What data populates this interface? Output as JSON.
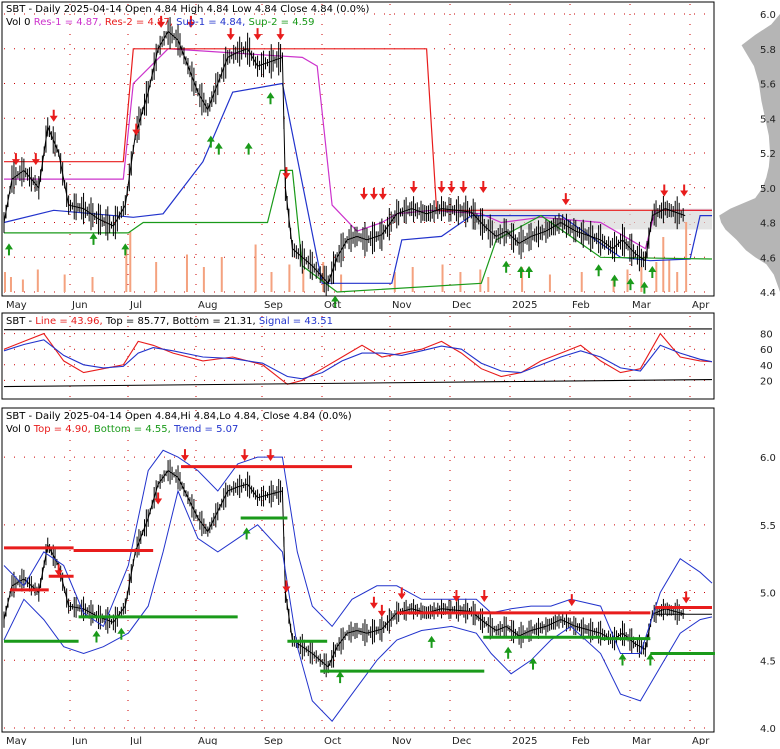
{
  "colors": {
    "price": "#000000",
    "volume": "#f4a27f",
    "resistance": "#e81c1c",
    "resistance_fast": "#cc33cc",
    "support": "#2233cc",
    "support_fast": "#1a9a1a",
    "profile": "#b5b5b5",
    "signal": "#2233cc",
    "line": "#e81c1c",
    "grid": "#cc0000",
    "arrow_up": "#1a9a1a",
    "arrow_down": "#e81c1c"
  },
  "months": [
    "May",
    "Jun",
    "Jul",
    "Aug",
    "Sep",
    "Oct",
    "Nov",
    "Dec",
    "2025",
    "Feb",
    "Mar",
    "Apr"
  ],
  "panel1": {
    "header_ticker": "SBT - Daily 2025-04-14 Open 4.84  High 4.84  Low 4.84  Close 4.84 (0.0%)",
    "legend": [
      {
        "text": "Vol 0",
        "color": "#000000"
      },
      {
        "text": "Res-1 = 4.87,",
        "color": "#cc33cc"
      },
      {
        "text": "Res-2 = 4.87,",
        "color": "#e81c1c"
      },
      {
        "text": "Sup-1 = 4.84,",
        "color": "#2233cc"
      },
      {
        "text": "Sup-2 = 4.59",
        "color": "#1a9a1a"
      }
    ],
    "y_ticks": [
      "6.0",
      "5.8",
      "5.6",
      "5.4",
      "5.2",
      "5.0",
      "4.8",
      "4.6",
      "4.4"
    ]
  },
  "panel2": {
    "header_ticker": "SBT -",
    "legend": [
      {
        "text": "Line = 43.96,",
        "color": "#e81c1c"
      },
      {
        "text": "Top = 85.77,",
        "color": "#000000"
      },
      {
        "text": "Bottom = 21.31,",
        "color": "#000000"
      },
      {
        "text": "Signal = 43.51",
        "color": "#2233cc"
      }
    ],
    "y_ticks": [
      "80",
      "60",
      "40",
      "20"
    ]
  },
  "panel3": {
    "header_ticker": "SBT - Daily 2025-04-14 Open 4.84,Hi 4.84,Lo 4.84, Close 4.84 (0.0%)",
    "legend": [
      {
        "text": "Vol 0",
        "color": "#000000"
      },
      {
        "text": "Top = 4.90,",
        "color": "#e81c1c"
      },
      {
        "text": "Bottom = 4.55,",
        "color": "#1a9a1a"
      },
      {
        "text": "Trend = 5.07",
        "color": "#2233cc"
      }
    ],
    "y_ticks": [
      "6.0",
      "5.5",
      "5.0",
      "4.5",
      "4.0"
    ]
  },
  "chart_data": [
    {
      "type": "line",
      "title": "SBT - Daily 2025-04-14",
      "panel": "price with support/resistance",
      "x_range": [
        "2024-05",
        "2025-04"
      ],
      "ylim": [
        4.4,
        6.0
      ],
      "series": [
        {
          "name": "Close",
          "values": [
            [
              0,
              4.8
            ],
            [
              8,
              5.05
            ],
            [
              20,
              5.1
            ],
            [
              35,
              5.0
            ],
            [
              44,
              5.35
            ],
            [
              55,
              5.2
            ],
            [
              65,
              4.9
            ],
            [
              80,
              4.88
            ],
            [
              95,
              4.82
            ],
            [
              110,
              4.78
            ],
            [
              122,
              4.9
            ],
            [
              132,
              5.3
            ],
            [
              145,
              5.55
            ],
            [
              155,
              5.8
            ],
            [
              165,
              5.9
            ],
            [
              175,
              5.85
            ],
            [
              185,
              5.7
            ],
            [
              195,
              5.55
            ],
            [
              205,
              5.45
            ],
            [
              215,
              5.6
            ],
            [
              225,
              5.75
            ],
            [
              235,
              5.78
            ],
            [
              245,
              5.8
            ],
            [
              255,
              5.7
            ],
            [
              265,
              5.72
            ],
            [
              280,
              5.75
            ],
            [
              283,
              5.0
            ],
            [
              290,
              4.65
            ],
            [
              300,
              4.6
            ],
            [
              310,
              4.55
            ],
            [
              318,
              4.5
            ],
            [
              326,
              4.45
            ],
            [
              335,
              4.6
            ],
            [
              345,
              4.7
            ],
            [
              355,
              4.72
            ],
            [
              365,
              4.7
            ],
            [
              380,
              4.73
            ],
            [
              395,
              4.85
            ],
            [
              410,
              4.88
            ],
            [
              425,
              4.85
            ],
            [
              440,
              4.88
            ],
            [
              455,
              4.87
            ],
            [
              470,
              4.86
            ],
            [
              483,
              4.78
            ],
            [
              495,
              4.72
            ],
            [
              505,
              4.75
            ],
            [
              518,
              4.68
            ],
            [
              530,
              4.72
            ],
            [
              545,
              4.75
            ],
            [
              560,
              4.8
            ],
            [
              575,
              4.75
            ],
            [
              590,
              4.72
            ],
            [
              600,
              4.7
            ],
            [
              612,
              4.65
            ],
            [
              622,
              4.7
            ],
            [
              635,
              4.62
            ],
            [
              645,
              4.58
            ],
            [
              652,
              4.84
            ],
            [
              665,
              4.88
            ],
            [
              675,
              4.86
            ],
            [
              685,
              4.84
            ]
          ]
        },
        {
          "name": "Res-1",
          "values": [
            [
              0,
              5.05
            ],
            [
              120,
              5.05
            ],
            [
              130,
              5.6
            ],
            [
              165,
              5.8
            ],
            [
              300,
              5.75
            ],
            [
              315,
              5.7
            ],
            [
              330,
              4.9
            ],
            [
              355,
              4.75
            ],
            [
              380,
              4.8
            ],
            [
              395,
              4.85
            ],
            [
              430,
              4.87
            ],
            [
              480,
              4.85
            ],
            [
              500,
              4.8
            ],
            [
              540,
              4.83
            ],
            [
              600,
              4.8
            ],
            [
              645,
              4.65
            ],
            [
              655,
              4.87
            ],
            [
              712,
              4.87
            ]
          ]
        },
        {
          "name": "Res-2",
          "values": [
            [
              0,
              5.15
            ],
            [
              120,
              5.15
            ],
            [
              130,
              5.8
            ],
            [
              425,
              5.8
            ],
            [
              435,
              4.87
            ],
            [
              712,
              4.87
            ]
          ]
        },
        {
          "name": "Sup-1",
          "values": [
            [
              0,
              4.8
            ],
            [
              50,
              4.87
            ],
            [
              130,
              4.83
            ],
            [
              160,
              4.85
            ],
            [
              200,
              5.15
            ],
            [
              230,
              5.55
            ],
            [
              280,
              5.6
            ],
            [
              320,
              4.45
            ],
            [
              390,
              4.45
            ],
            [
              400,
              4.7
            ],
            [
              440,
              4.72
            ],
            [
              470,
              4.84
            ],
            [
              560,
              4.84
            ],
            [
              620,
              4.6
            ],
            [
              650,
              4.58
            ],
            [
              690,
              4.59
            ],
            [
              700,
              4.84
            ],
            [
              712,
              4.84
            ]
          ]
        },
        {
          "name": "Sup-2",
          "values": [
            [
              0,
              4.74
            ],
            [
              125,
              4.74
            ],
            [
              140,
              4.8
            ],
            [
              265,
              4.8
            ],
            [
              278,
              5.1
            ],
            [
              290,
              5.1
            ],
            [
              300,
              4.55
            ],
            [
              335,
              4.4
            ],
            [
              480,
              4.45
            ],
            [
              495,
              4.7
            ],
            [
              540,
              4.84
            ],
            [
              600,
              4.6
            ],
            [
              712,
              4.59
            ]
          ]
        }
      ],
      "volume_note": "Vol 0"
    },
    {
      "type": "line",
      "panel": "oscillator",
      "ylim": [
        0,
        100
      ],
      "series": [
        {
          "name": "Line",
          "values": [
            [
              0,
              60
            ],
            [
              20,
              70
            ],
            [
              40,
              80
            ],
            [
              60,
              45
            ],
            [
              80,
              30
            ],
            [
              100,
              35
            ],
            [
              120,
              40
            ],
            [
              135,
              70
            ],
            [
              150,
              65
            ],
            [
              170,
              55
            ],
            [
              200,
              45
            ],
            [
              230,
              50
            ],
            [
              260,
              40
            ],
            [
              285,
              15
            ],
            [
              300,
              20
            ],
            [
              320,
              35
            ],
            [
              340,
              50
            ],
            [
              360,
              65
            ],
            [
              380,
              50
            ],
            [
              400,
              55
            ],
            [
              420,
              60
            ],
            [
              440,
              70
            ],
            [
              460,
              55
            ],
            [
              480,
              35
            ],
            [
              500,
              25
            ],
            [
              520,
              30
            ],
            [
              540,
              45
            ],
            [
              560,
              55
            ],
            [
              580,
              65
            ],
            [
              600,
              45
            ],
            [
              620,
              30
            ],
            [
              640,
              35
            ],
            [
              660,
              80
            ],
            [
              680,
              50
            ],
            [
              700,
              45
            ],
            [
              712,
              44
            ]
          ]
        },
        {
          "name": "Signal",
          "values": [
            [
              0,
              58
            ],
            [
              20,
              66
            ],
            [
              40,
              72
            ],
            [
              60,
              52
            ],
            [
              80,
              40
            ],
            [
              100,
              36
            ],
            [
              120,
              38
            ],
            [
              135,
              55
            ],
            [
              150,
              62
            ],
            [
              170,
              58
            ],
            [
              200,
              50
            ],
            [
              230,
              48
            ],
            [
              260,
              42
            ],
            [
              285,
              25
            ],
            [
              300,
              22
            ],
            [
              320,
              30
            ],
            [
              340,
              45
            ],
            [
              360,
              55
            ],
            [
              380,
              55
            ],
            [
              400,
              52
            ],
            [
              420,
              58
            ],
            [
              440,
              64
            ],
            [
              460,
              60
            ],
            [
              480,
              42
            ],
            [
              500,
              32
            ],
            [
              520,
              30
            ],
            [
              540,
              40
            ],
            [
              560,
              50
            ],
            [
              580,
              58
            ],
            [
              600,
              50
            ],
            [
              620,
              36
            ],
            [
              640,
              32
            ],
            [
              660,
              65
            ],
            [
              680,
              55
            ],
            [
              700,
              47
            ],
            [
              712,
              44
            ]
          ]
        },
        {
          "name": "Top",
          "values": [
            [
              0,
              85
            ],
            [
              712,
              86
            ]
          ]
        },
        {
          "name": "Bottom",
          "values": [
            [
              0,
              12
            ],
            [
              712,
              21
            ]
          ]
        }
      ]
    },
    {
      "type": "line",
      "panel": "price with trend channel",
      "ylim": [
        4.0,
        6.2
      ],
      "series": [
        {
          "name": "Top",
          "values": [
            [
              0,
              4.9
            ],
            [
              712,
              4.9
            ]
          ]
        },
        {
          "name": "Bottom",
          "values": [
            [
              0,
              4.55
            ],
            [
              712,
              4.55
            ]
          ]
        },
        {
          "name": "Trend",
          "values": [
            [
              712,
              5.07
            ]
          ]
        }
      ]
    }
  ]
}
